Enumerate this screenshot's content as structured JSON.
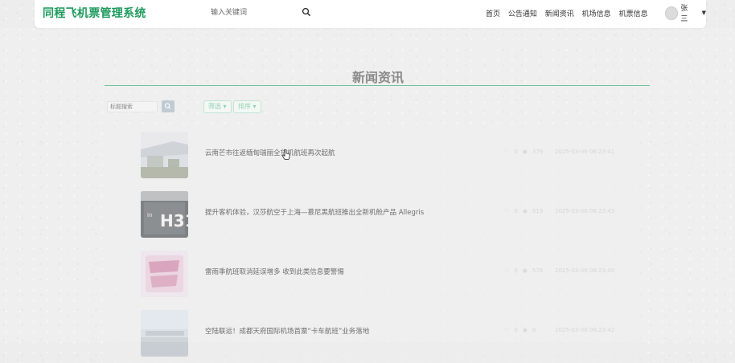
{
  "header": {
    "brand": "同程飞机票管理系统",
    "search_placeholder": "输入关键词",
    "nav": [
      "首页",
      "公告通知",
      "新闻资讯",
      "机场信息",
      "机票信息"
    ],
    "user_name": "张三"
  },
  "page": {
    "title": "新闻资讯",
    "filter_placeholder": "标题搜索",
    "filter_label": "筛选",
    "sort_label": "排序"
  },
  "news": [
    {
      "title": "云南芒市往返缅甸瑞丽全货机航班再次起航",
      "likes": "0",
      "views": "379",
      "date": "2025-03-06 08:23:41"
    },
    {
      "title": "提升客机体验，汉莎航空于上海—慕尼黑航班推出全新机舱产品 Allegris",
      "likes": "0",
      "views": "919",
      "date": "2025-03-06 08:23:43"
    },
    {
      "title": "雷雨季航班取消延误增多 收到此类信息要警惕",
      "likes": "0",
      "views": "576",
      "date": "2025-03-06 08:23:40"
    },
    {
      "title": "空陆联运！成都天府国际机场首票“卡车航班”业务落地",
      "likes": "0",
      "views": "8",
      "date": "2025-03-06 08:23:42"
    }
  ],
  "colors": {
    "brand": "#1e9a5c",
    "accent": "#3aa979"
  }
}
